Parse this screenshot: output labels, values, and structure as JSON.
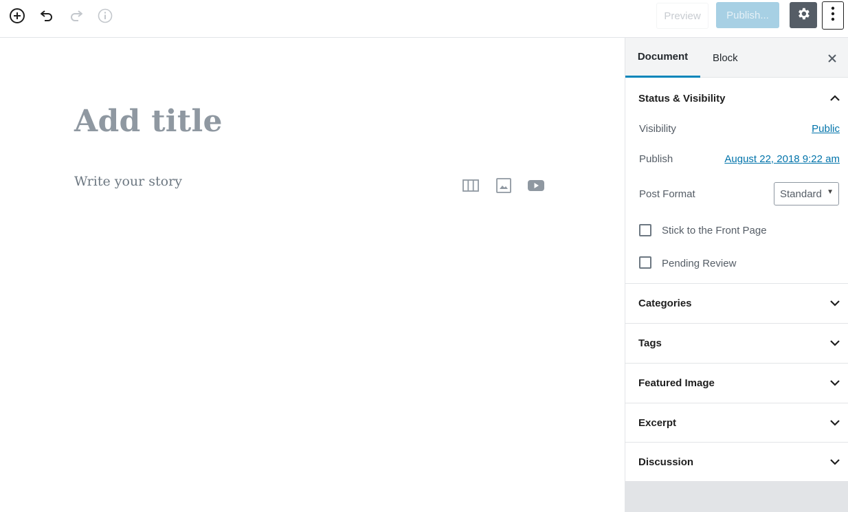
{
  "toolbar": {
    "icons": [
      "add-block-icon",
      "undo-icon",
      "redo-icon",
      "info-icon",
      "gear-icon",
      "more-vertical-icon"
    ],
    "preview_label": "Preview",
    "publish_label": "Publish..."
  },
  "editor": {
    "title_placeholder": "Add title",
    "body_placeholder": "Write your story",
    "quick_inserters": [
      "columns-icon",
      "image-icon",
      "video-icon"
    ]
  },
  "sidebar": {
    "tabs": [
      {
        "label": "Document",
        "active": true
      },
      {
        "label": "Block",
        "active": false
      }
    ],
    "status_panel": {
      "title": "Status & Visibility",
      "expanded": true,
      "visibility_label": "Visibility",
      "visibility_value": "Public",
      "publish_label": "Publish",
      "publish_value": "August 22, 2018 9:22 am",
      "post_format_label": "Post Format",
      "post_format_value": "Standard",
      "stick_label": "Stick to the Front Page",
      "stick_checked": false,
      "pending_label": "Pending Review",
      "pending_checked": false
    },
    "panels": [
      {
        "title": "Categories",
        "expanded": false
      },
      {
        "title": "Tags",
        "expanded": false
      },
      {
        "title": "Featured Image",
        "expanded": false
      },
      {
        "title": "Excerpt",
        "expanded": false
      },
      {
        "title": "Discussion",
        "expanded": false
      }
    ]
  },
  "colors": {
    "accent": "#0085ba",
    "link": "#0073aa",
    "publish_disabled": "#a7d0e4",
    "settings_active": "#555d66"
  }
}
